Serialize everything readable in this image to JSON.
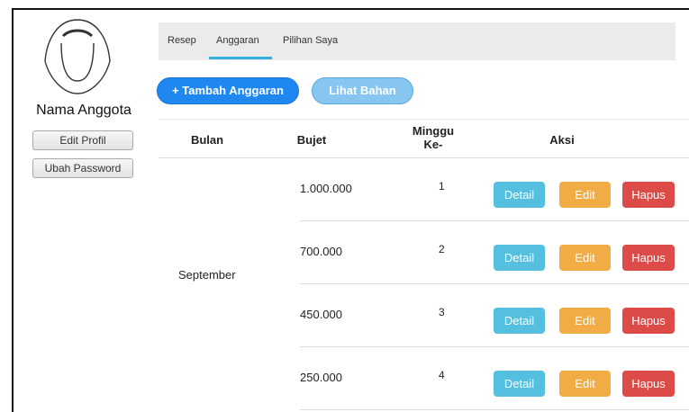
{
  "sidebar": {
    "member_name": "Nama Anggota",
    "edit_profile": "Edit Profil",
    "change_password": "Ubah Password"
  },
  "tabs": [
    {
      "label": "Resep"
    },
    {
      "label": "Anggaran",
      "active": true
    },
    {
      "label": "Pilihan Saya"
    }
  ],
  "actions": {
    "add_budget": "+ Tambah Anggaran",
    "view_ingredients": "Lihat Bahan"
  },
  "table": {
    "headers": {
      "month": "Bulan",
      "budget": "Bujet",
      "week_line1": "Minggu",
      "week_line2": "Ke-",
      "action": "Aksi"
    },
    "month": "September",
    "rows": [
      {
        "budget": "1.000.000",
        "week": "1"
      },
      {
        "budget": "700.000",
        "week": "2"
      },
      {
        "budget": "450.000",
        "week": "3"
      },
      {
        "budget": "250.000",
        "week": "4"
      }
    ],
    "row_actions": {
      "detail": "Detail",
      "edit": "Edit",
      "delete": "Hapus"
    }
  },
  "colors": {
    "primary": "#1e87f0",
    "secondary": "#86c6f0",
    "info": "#55bfe0",
    "warning": "#f2ac45",
    "danger": "#dc4b48",
    "tab_accent": "#35aee0"
  }
}
